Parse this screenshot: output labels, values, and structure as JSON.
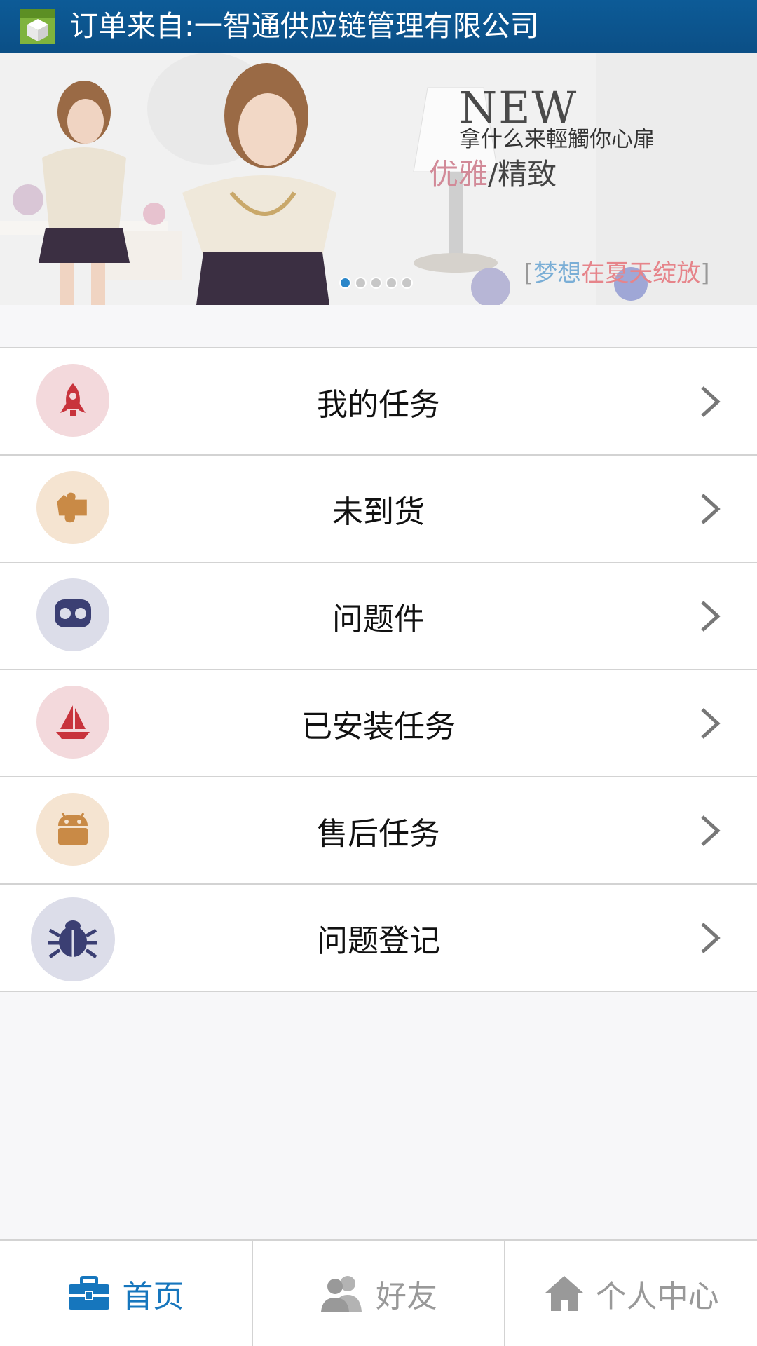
{
  "titlebar": {
    "title": "订单来自:一智通供应链管理有限公司",
    "icon": "package-box-icon"
  },
  "banner": {
    "headline": "NEW",
    "tagline": "拿什么来輕觸你心扉",
    "slogan_pink": "优雅",
    "slogan_sep": "/",
    "slogan_rest": "精致",
    "bracket_open": "[",
    "bracket_close": "]",
    "dream_blue": "梦想",
    "dream_red": "在夏天绽放",
    "slides_total": 5,
    "slide_active": 1
  },
  "menu": [
    {
      "label": "我的任务",
      "icon": "rocket-icon",
      "color": "#c8333c",
      "bg": "#f3d9dc"
    },
    {
      "label": "未到货",
      "icon": "puzzle-icon",
      "color": "#c98a46",
      "bg": "#f5e4d1"
    },
    {
      "label": "问题件",
      "icon": "mask-icon",
      "color": "#3b3f73",
      "bg": "#dcdde9"
    },
    {
      "label": "已安装任务",
      "icon": "sailboat-icon",
      "color": "#c8333c",
      "bg": "#f3d9dc"
    },
    {
      "label": "售后任务",
      "icon": "android-icon",
      "color": "#c98a46",
      "bg": "#f5e4d1"
    },
    {
      "label": "问题登记",
      "icon": "bug-icon",
      "color": "#3b3f73",
      "bg": "#dcdde9"
    }
  ],
  "nav": [
    {
      "label": "首页",
      "icon": "briefcase-icon",
      "active": true
    },
    {
      "label": "好友",
      "icon": "friends-icon",
      "active": false
    },
    {
      "label": "个人中心",
      "icon": "home-icon",
      "active": false
    }
  ],
  "colors": {
    "accent": "#1676bd",
    "titlebar": "#0b4f86",
    "inactive": "#999999"
  }
}
